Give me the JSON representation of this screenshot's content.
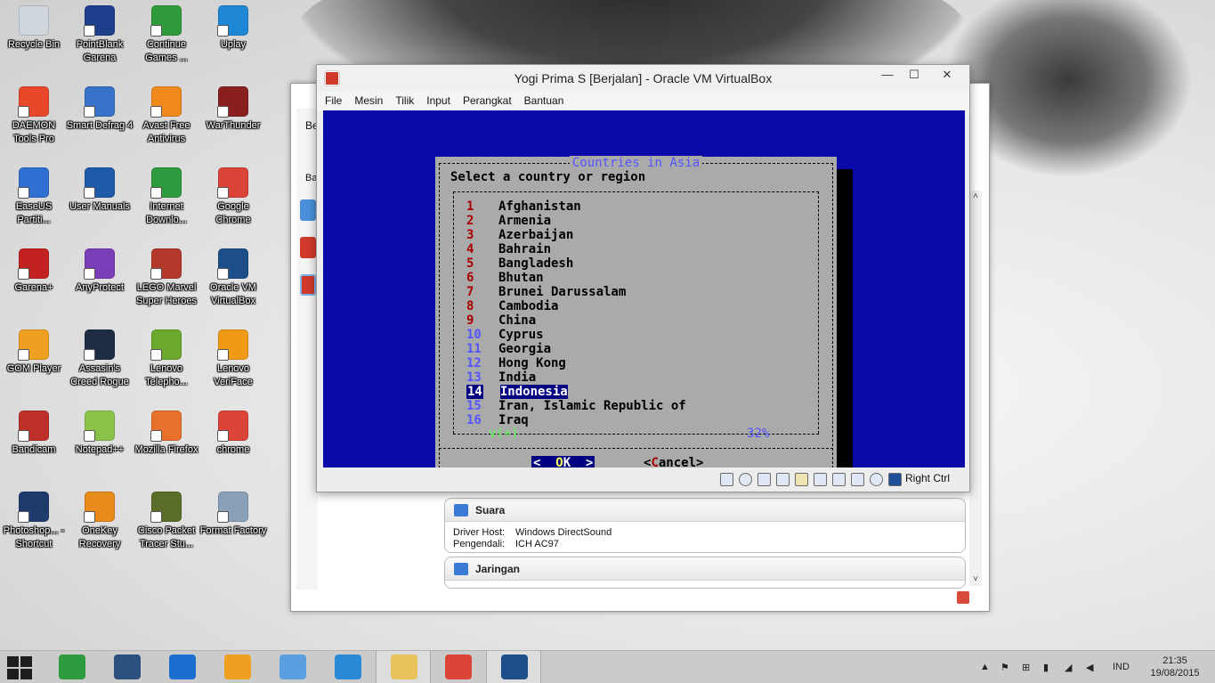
{
  "desktop": {
    "icons": [
      {
        "label": "Recycle Bin",
        "color": "#cfd6dc"
      },
      {
        "label": "PointBlank Garena",
        "color": "#1d3f8c"
      },
      {
        "label": "Continue Games ...",
        "color": "#2f9a3a"
      },
      {
        "label": "Uplay",
        "color": "#1e88d6"
      },
      {
        "label": "DAEMON Tools Pro",
        "color": "#e8472a"
      },
      {
        "label": "Smart Defrag 4",
        "color": "#3773c8"
      },
      {
        "label": "Avast Free Antivirus",
        "color": "#f08a1c"
      },
      {
        "label": "WarThunder",
        "color": "#8a1f1f"
      },
      {
        "label": "EaseUS Partiti...",
        "color": "#2f6fd1"
      },
      {
        "label": "User Manuals",
        "color": "#1f5aa8"
      },
      {
        "label": "Internet Downlo...",
        "color": "#2e9b3e"
      },
      {
        "label": "Google Chrome",
        "color": "#db4437"
      },
      {
        "label": "Garena+",
        "color": "#c22222"
      },
      {
        "label": "AnyProtect",
        "color": "#7a3fb8"
      },
      {
        "label": "LEGO Marvel Super Heroes",
        "color": "#b5392b"
      },
      {
        "label": "Oracle VM VirtualBox",
        "color": "#1c4f8a"
      },
      {
        "label": "GOM Player",
        "color": "#f0a020"
      },
      {
        "label": "Assasin's Creed Rogue",
        "color": "#1e2d44"
      },
      {
        "label": "Lenovo Telepho...",
        "color": "#6aa82e"
      },
      {
        "label": "Lenovo VeriFace",
        "color": "#f09a18"
      },
      {
        "label": "Bandicam",
        "color": "#c0302a"
      },
      {
        "label": "Notepad++",
        "color": "#8bc34a"
      },
      {
        "label": "Mozilla Firefox",
        "color": "#e8702a"
      },
      {
        "label": "chrome",
        "color": "#db4437"
      },
      {
        "label": "Photoshop... - Shortcut",
        "color": "#1f3b6e"
      },
      {
        "label": "OneKey Recovery",
        "color": "#e88a1c"
      },
      {
        "label": "Cisco Packet Tracer Stu...",
        "color": "#5a6e2a"
      },
      {
        "label": "Format Factory",
        "color": "#8aa0b8"
      }
    ]
  },
  "vbox_manager": {
    "left_tab_label": "Be",
    "left_tab_label2": "Ba",
    "panels": [
      {
        "title": "Suara",
        "rows": [
          {
            "key": "Driver Host:",
            "value": "Windows DirectSound"
          },
          {
            "key": "Pengendali:",
            "value": "ICH AC97"
          }
        ]
      },
      {
        "title": "Jaringan",
        "rows": []
      }
    ],
    "scroll_up": "˄",
    "scroll_down": "˅"
  },
  "vm_window": {
    "title": "Yogi Prima S [Berjalan] - Oracle VM VirtualBox",
    "minimize": "—",
    "maximize": "☐",
    "close": "✕",
    "menu": [
      "File",
      "Mesin",
      "Tilik",
      "Input",
      "Perangkat",
      "Bantuan"
    ],
    "host_key": "Right Ctrl"
  },
  "dialog": {
    "title": "Countries in Asia",
    "prompt": "Select a country or region",
    "items": [
      {
        "num": "1",
        "name": "Afghanistan"
      },
      {
        "num": "2",
        "name": "Armenia"
      },
      {
        "num": "3",
        "name": "Azerbaijan"
      },
      {
        "num": "4",
        "name": "Bahrain"
      },
      {
        "num": "5",
        "name": "Bangladesh"
      },
      {
        "num": "6",
        "name": "Bhutan"
      },
      {
        "num": "7",
        "name": "Brunei Darussalam"
      },
      {
        "num": "8",
        "name": "Cambodia"
      },
      {
        "num": "9",
        "name": "China"
      },
      {
        "num": "10",
        "name": "Cyprus"
      },
      {
        "num": "11",
        "name": "Georgia"
      },
      {
        "num": "12",
        "name": "Hong Kong"
      },
      {
        "num": "13",
        "name": "India"
      },
      {
        "num": "14",
        "name": "Indonesia"
      },
      {
        "num": "15",
        "name": "Iran, Islamic Republic of"
      },
      {
        "num": "16",
        "name": "Iraq"
      }
    ],
    "selected_index": 13,
    "scroll_indicator": "v(+)",
    "scroll_percent": "32%",
    "ok_left": "<",
    "ok_hotkey": "O",
    "ok_rest": "K",
    "ok_right": ">",
    "cancel_left": "<",
    "cancel_hotkey": "C",
    "cancel_rest": "ancel>"
  },
  "taskbar": {
    "apps": [
      {
        "name": "store",
        "color": "#2e9b3e"
      },
      {
        "name": "lenovo",
        "color": "#2b4f7e"
      },
      {
        "name": "maxthon",
        "color": "#1b6fd0"
      },
      {
        "name": "gom",
        "color": "#f0a020"
      },
      {
        "name": "game",
        "color": "#5aa0e0"
      },
      {
        "name": "internet-explorer",
        "color": "#2a8ad8"
      },
      {
        "name": "file-explorer",
        "color": "#e8c25a"
      },
      {
        "name": "chrome",
        "color": "#db4437"
      },
      {
        "name": "virtualbox",
        "color": "#1c4f8a"
      }
    ],
    "language": "IND",
    "time": "21:35",
    "date": "19/08/2015"
  }
}
